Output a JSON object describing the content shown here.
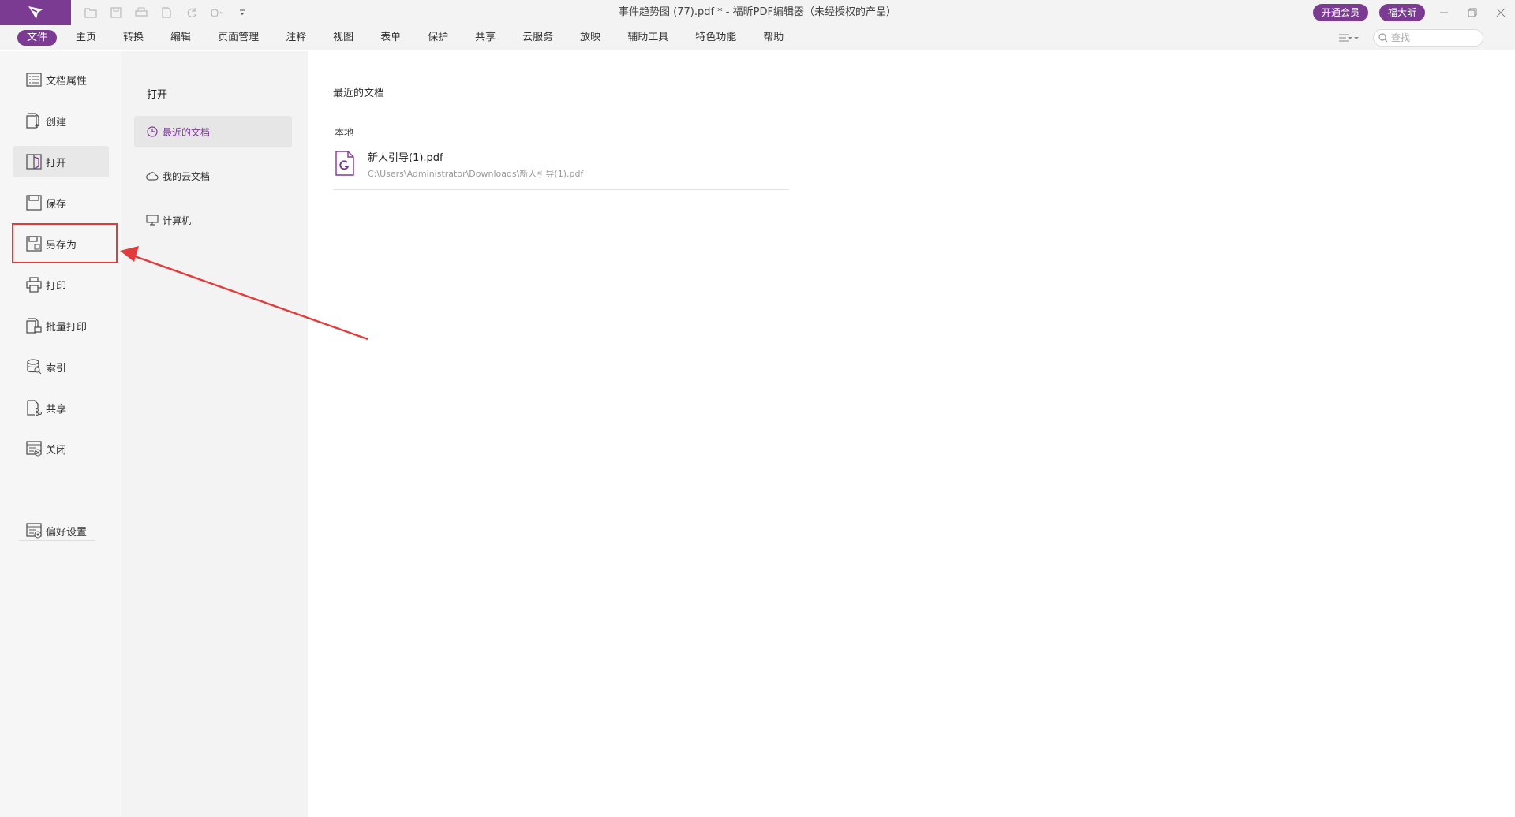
{
  "window": {
    "title": "事件趋势图 (77).pdf * - 福昕PDF编辑器（未经授权的产品）",
    "vip_button": "开通会员",
    "user_button": "福大昕"
  },
  "menubar": {
    "items": [
      {
        "label": "文件",
        "active": true
      },
      {
        "label": "主页"
      },
      {
        "label": "转换"
      },
      {
        "label": "编辑"
      },
      {
        "label": "页面管理"
      },
      {
        "label": "注释"
      },
      {
        "label": "视图"
      },
      {
        "label": "表单"
      },
      {
        "label": "保护"
      },
      {
        "label": "共享"
      },
      {
        "label": "云服务"
      },
      {
        "label": "放映"
      },
      {
        "label": "辅助工具"
      },
      {
        "label": "特色功能"
      },
      {
        "label": "帮助"
      }
    ],
    "search_placeholder": "查找"
  },
  "leftnav": {
    "items": [
      {
        "label": "文档属性",
        "icon": "document-properties-icon"
      },
      {
        "label": "创建",
        "icon": "create-document-icon"
      },
      {
        "label": "打开",
        "icon": "open-folder-icon",
        "selected": true
      },
      {
        "label": "保存",
        "icon": "save-icon"
      },
      {
        "label": "另存为",
        "icon": "save-as-icon"
      },
      {
        "label": "打印",
        "icon": "printer-icon"
      },
      {
        "label": "批量打印",
        "icon": "batch-print-icon"
      },
      {
        "label": "索引",
        "icon": "index-icon"
      },
      {
        "label": "共享",
        "icon": "share-icon"
      },
      {
        "label": "关闭",
        "icon": "close-document-icon"
      }
    ],
    "preferences": {
      "label": "偏好设置",
      "icon": "preferences-icon"
    }
  },
  "open_panel": {
    "title": "打开",
    "items": [
      {
        "label": "最近的文档",
        "icon": "clock-icon",
        "selected": true
      },
      {
        "label": "我的云文档",
        "icon": "cloud-icon"
      },
      {
        "label": "计算机",
        "icon": "computer-icon"
      }
    ]
  },
  "content": {
    "title": "最近的文档",
    "section": "本地",
    "files": [
      {
        "name": "新人引导(1).pdf",
        "path": "C:\\Users\\Administrator\\Downloads\\新人引导(1).pdf"
      }
    ]
  },
  "colors": {
    "accent": "#7b3b93",
    "annotation": "#e23b3b"
  }
}
